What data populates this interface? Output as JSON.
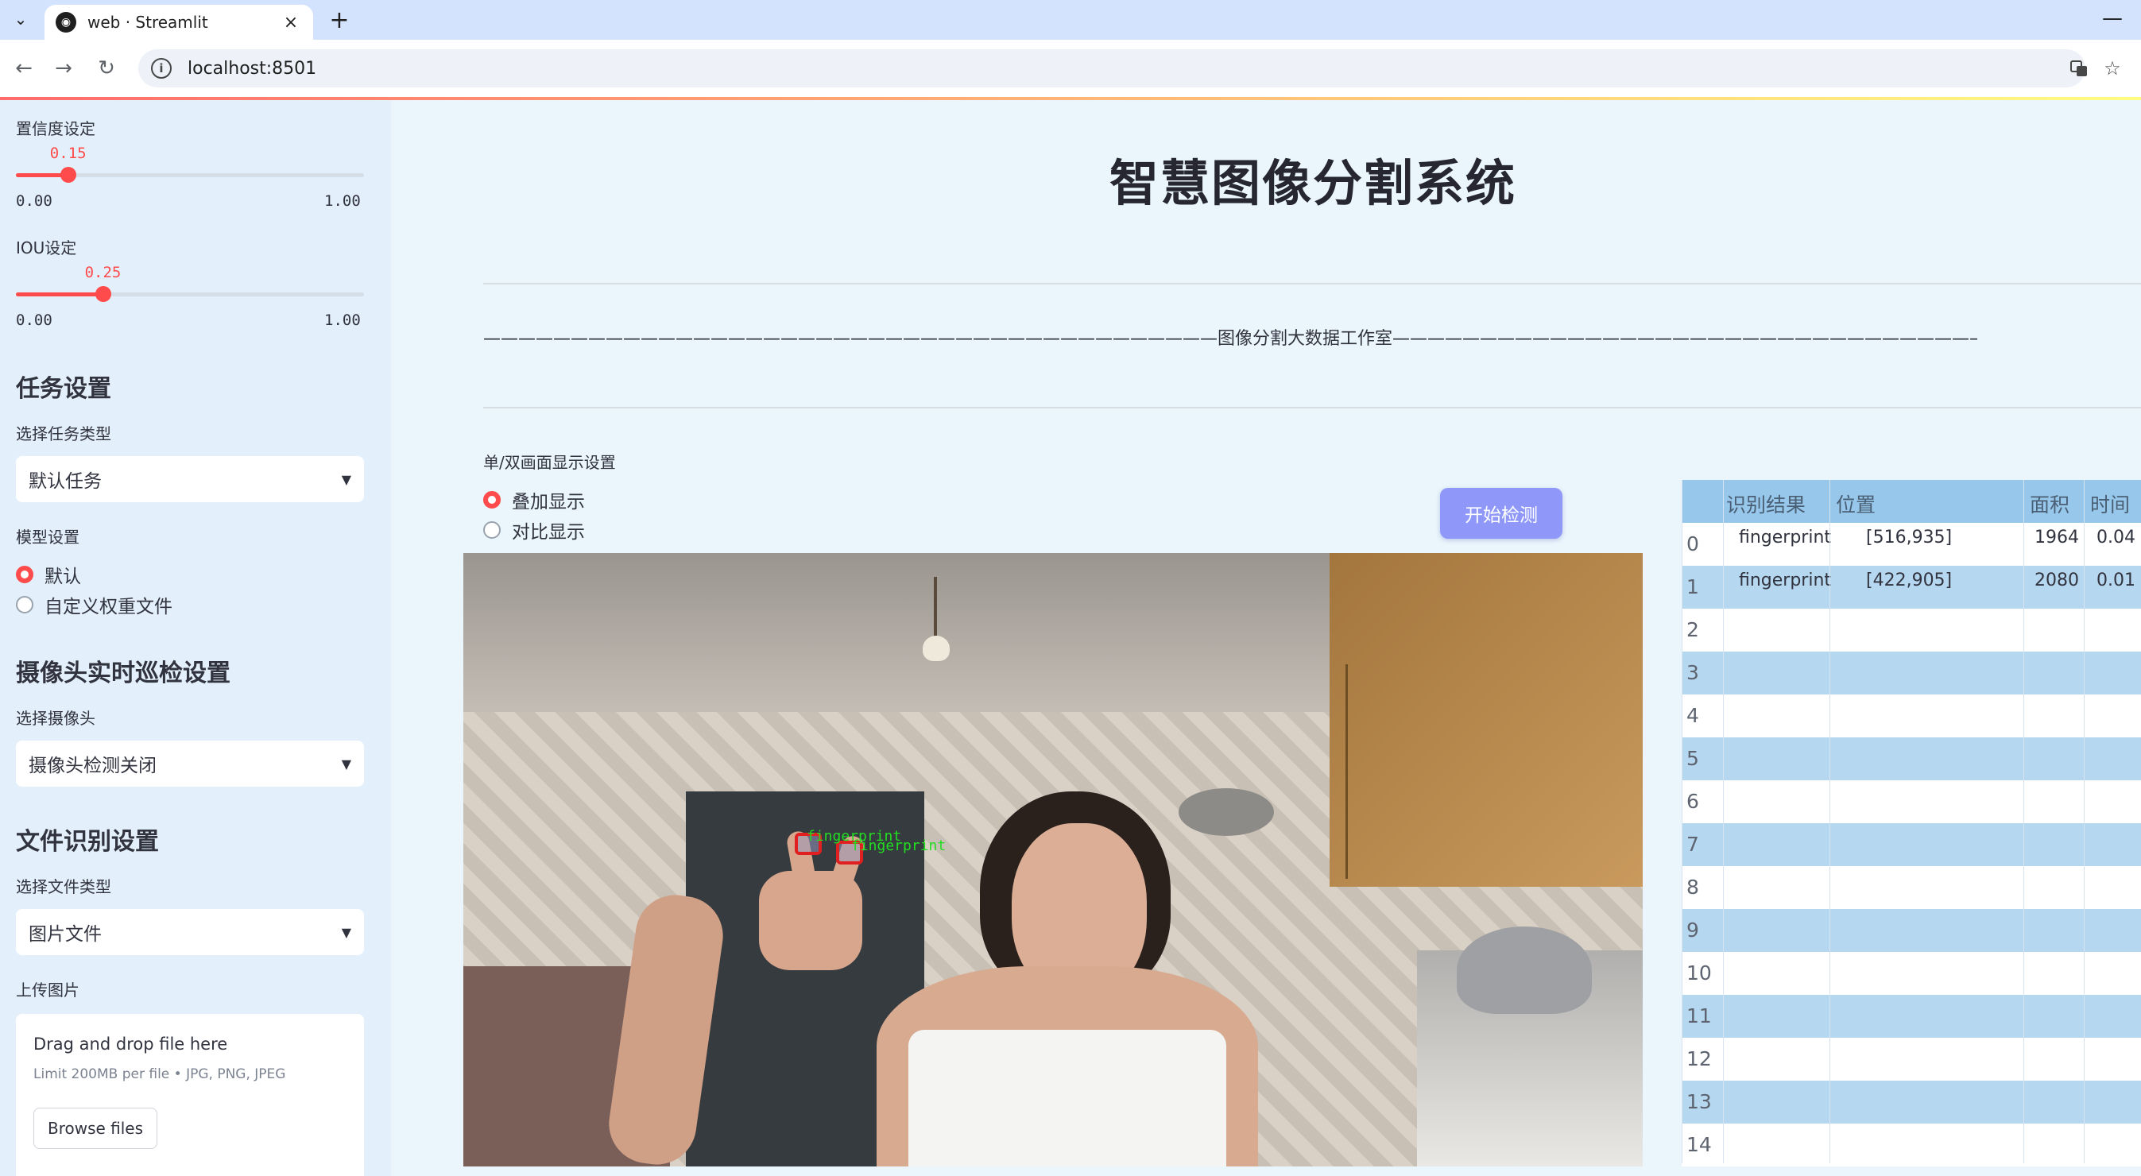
{
  "browser": {
    "tab_title": "web · Streamlit",
    "url": "localhost:8501",
    "tab_close": "×",
    "new_tab": "+",
    "minimize": "—"
  },
  "sidebar": {
    "confidence_label": "置信度设定",
    "confidence": {
      "value": 0.15,
      "value_text": "0.15",
      "min": "0.00",
      "max": "1.00"
    },
    "iou_label": "IOU设定",
    "iou": {
      "value": 0.25,
      "value_text": "0.25",
      "min": "0.00",
      "max": "1.00"
    },
    "task_heading": "任务设置",
    "task_type_label": "选择任务类型",
    "task_type_value": "默认任务",
    "model_label": "模型设置",
    "model_options": [
      "默认",
      "自定义权重文件"
    ],
    "model_selected": 0,
    "camera_heading": "摄像头实时巡检设置",
    "camera_label": "选择摄像头",
    "camera_value": "摄像头检测关闭",
    "file_heading": "文件识别设置",
    "file_type_label": "选择文件类型",
    "file_type_value": "图片文件",
    "upload_label": "上传图片",
    "upload_title": "Drag and drop file here",
    "upload_sub": "Limit 200MB per file • JPG, PNG, JPEG",
    "browse_label": "Browse files"
  },
  "main": {
    "title": "智慧图像分割系统",
    "divider_text": "——————————————————————————————————————————图像分割大数据工作室——————————————————————————————————————————",
    "display_mode_label": "单/双画面显示设置",
    "display_options": [
      "叠加显示",
      "对比显示"
    ],
    "display_selected": 0,
    "start_button": "开始检测"
  },
  "detections_overlay": [
    "fingerprint",
    "fingerprint"
  ],
  "table": {
    "headers": [
      "识别结果",
      "位置",
      "面积",
      "时间"
    ],
    "rows": [
      {
        "index": "0",
        "result": "fingerprint",
        "position": "[516,935]",
        "area": "1964",
        "time": "0.04"
      },
      {
        "index": "1",
        "result": "fingerprint",
        "position": "[422,905]",
        "area": "2080",
        "time": "0.01"
      },
      {
        "index": "2"
      },
      {
        "index": "3"
      },
      {
        "index": "4"
      },
      {
        "index": "5"
      },
      {
        "index": "6"
      },
      {
        "index": "7"
      },
      {
        "index": "8"
      },
      {
        "index": "9"
      },
      {
        "index": "10"
      },
      {
        "index": "11"
      },
      {
        "index": "12"
      },
      {
        "index": "13"
      },
      {
        "index": "14"
      }
    ]
  },
  "colors": {
    "accent": "#ff4b4b",
    "button": "#8f98f8",
    "table_header": "#97c8ec",
    "table_stripe": "#b6d7f0",
    "sidebar_bg": "#e3f0fb",
    "main_bg": "#eaf6fb",
    "box_red": "#e02020",
    "label_green": "#22dd22"
  },
  "icons": [
    "chevron-down-icon",
    "streamlit-favicon",
    "back-arrow-icon",
    "forward-arrow-icon",
    "reload-icon",
    "info-icon",
    "translate-icon",
    "star-icon",
    "caret-down-icon"
  ]
}
